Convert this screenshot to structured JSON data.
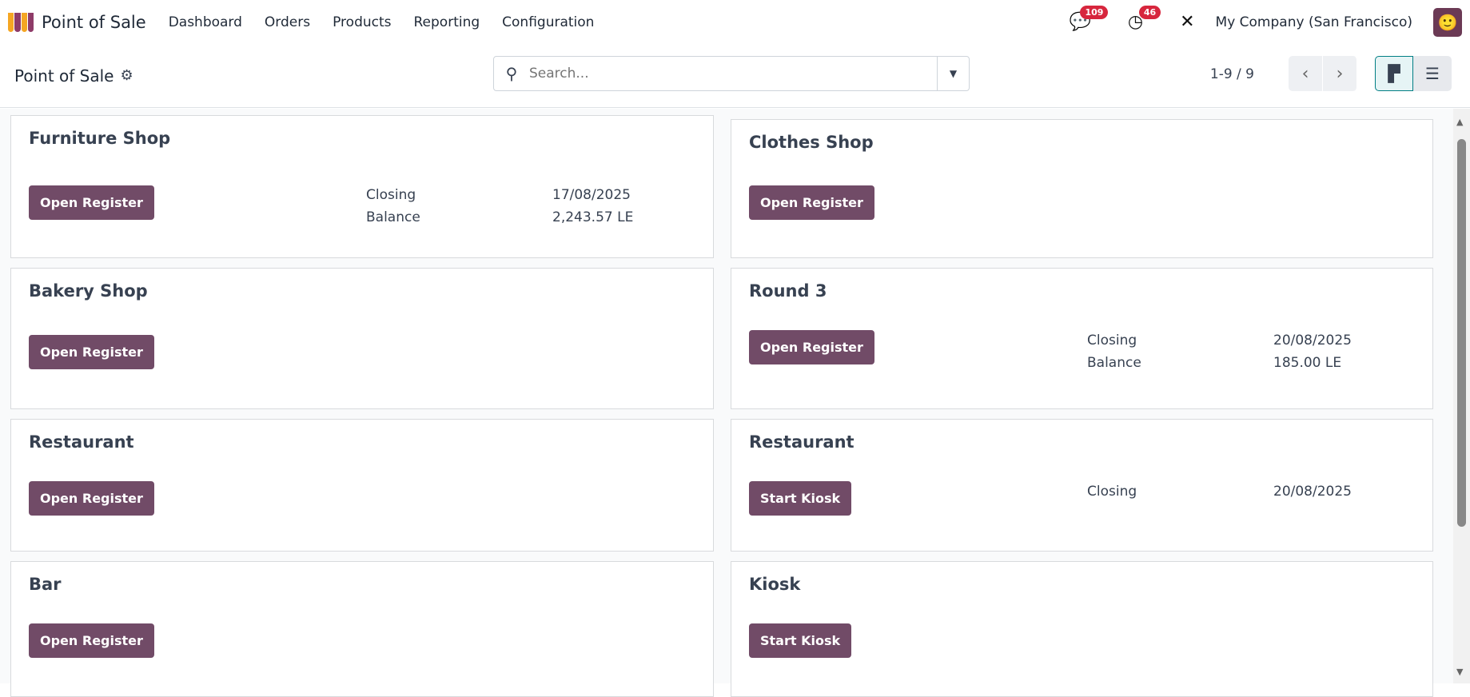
{
  "nav": {
    "app_name": "Point of Sale",
    "menu": [
      "Dashboard",
      "Orders",
      "Products",
      "Reporting",
      "Configuration"
    ],
    "messages_count": "109",
    "activities_count": "46",
    "company": "My Company (San Francisco)"
  },
  "control": {
    "title": "Point of Sale",
    "search_placeholder": "Search...",
    "pager": "1-9 / 9"
  },
  "colors": {
    "primary": "#714B67",
    "badge": "#D7263D"
  },
  "cards": [
    {
      "name": "Furniture Shop",
      "button": "Open Register",
      "closing_label": "Closing",
      "closing": "17/08/2025",
      "balance_label": "Balance",
      "balance": "2,243.57 LE"
    },
    {
      "name": "Clothes Shop",
      "button": "Open Register"
    },
    {
      "name": "Bakery Shop",
      "button": "Open Register"
    },
    {
      "name": "Round 3",
      "button": "Open Register",
      "closing_label": "Closing",
      "closing": "20/08/2025",
      "balance_label": "Balance",
      "balance": "185.00 LE"
    },
    {
      "name": "Restaurant",
      "button": "Open Register"
    },
    {
      "name": "Restaurant",
      "button": "Start Kiosk",
      "closing_label": "Closing",
      "closing": "20/08/2025"
    },
    {
      "name": "Bar",
      "button": "Open Register"
    },
    {
      "name": "Kiosk",
      "button": "Start Kiosk"
    }
  ]
}
